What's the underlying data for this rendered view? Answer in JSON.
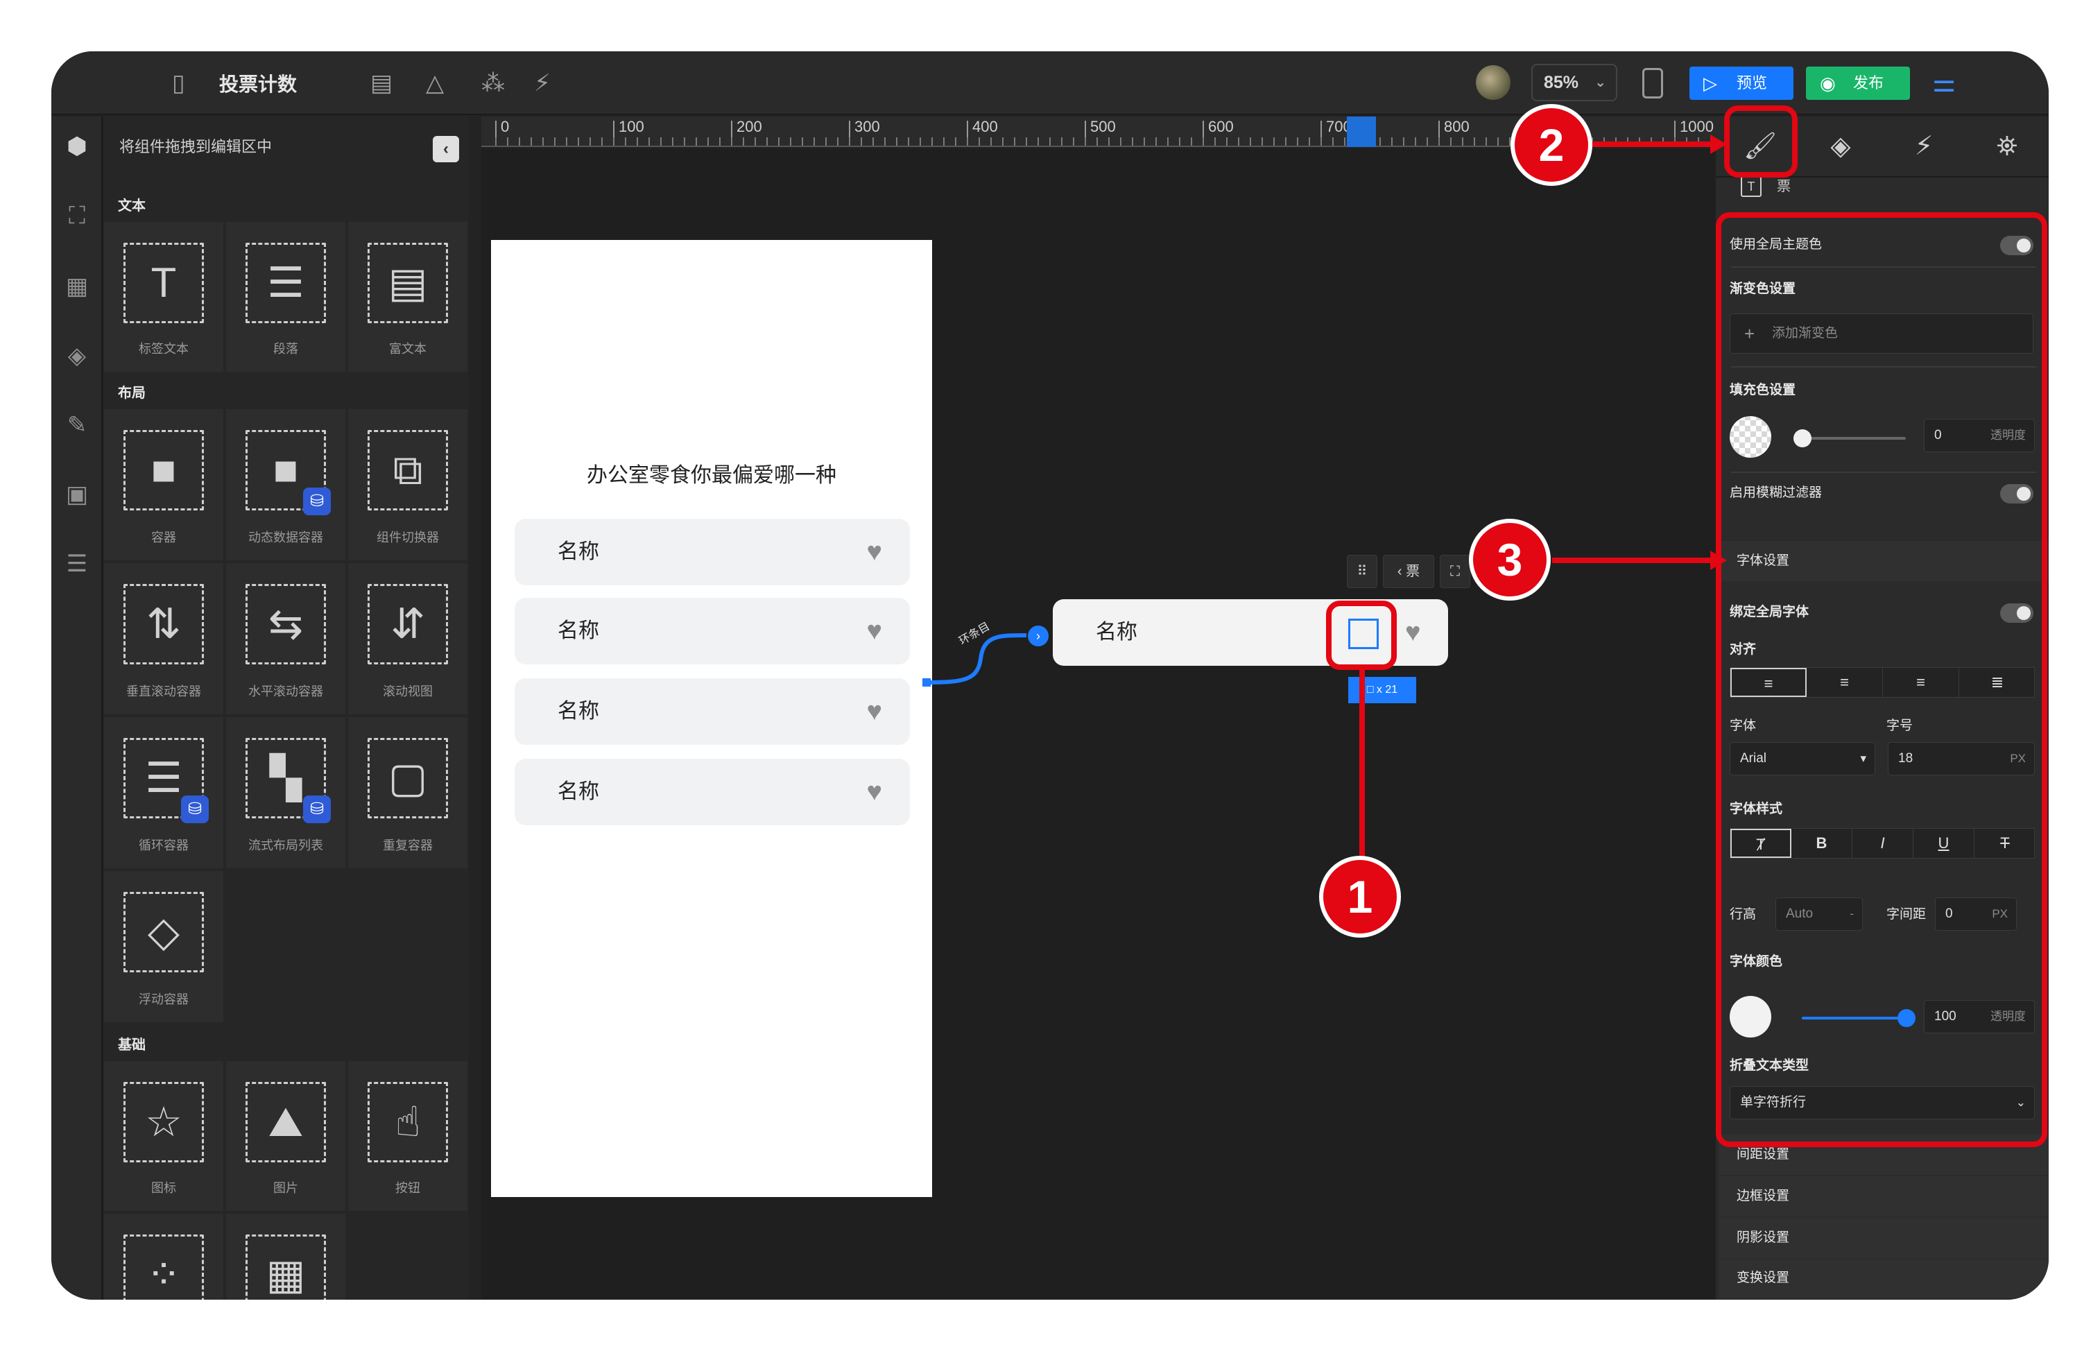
{
  "topbar": {
    "title": "投票计数",
    "zoom": "85%",
    "preview_label": "预览",
    "publish_label": "发布"
  },
  "left_panel": {
    "hint": "将组件拖拽到编辑区中",
    "sections": {
      "text": "文本",
      "layout": "布局",
      "basic": "基础"
    },
    "components": {
      "label_text": "标签文本",
      "paragraph": "段落",
      "rich_text": "富文本",
      "container": "容器",
      "dynamic_container": "动态数据容器",
      "component_switcher": "组件切换器",
      "vertical_scroll": "垂直滚动容器",
      "horizontal_scroll": "水平滚动容器",
      "scroll_view": "滚动视图",
      "loop_container": "循环容器",
      "flow_list": "流式布局列表",
      "repeat_container": "重复容器",
      "floating_container": "浮动容器",
      "icon": "图标",
      "image": "图片",
      "button": "按钮"
    }
  },
  "ruler": {
    "labels": [
      "0",
      "100",
      "200",
      "300",
      "400",
      "500",
      "600",
      "700",
      "800",
      "1000"
    ]
  },
  "canvas": {
    "screen_title": "办公室零食你最偏爱哪一种",
    "options": [
      "名称",
      "名称",
      "名称",
      "名称"
    ],
    "floating_item_name": "名称",
    "flow_label": "环条目",
    "mini_toolbar_tag": "票",
    "size_tag": "□ x 21"
  },
  "right_panel": {
    "element_type_label": "票",
    "use_global_theme": "使用全局主题色",
    "gradient_settings": "渐变色设置",
    "add_gradient": "添加渐变色",
    "fill_settings": "填充色设置",
    "fill_opacity_value": "0",
    "opacity_label": "透明度",
    "blur_filter": "启用模糊过滤器",
    "font_settings": "字体设置",
    "bind_global_font": "绑定全局字体",
    "align_label": "对齐",
    "font_label": "字体",
    "font_size_label": "字号",
    "font_family_value": "Arial",
    "font_size_value": "18",
    "unit_px": "PX",
    "font_style_label": "字体样式",
    "line_height_label": "行高",
    "line_height_value": "Auto",
    "letter_spacing_label": "字间距",
    "letter_spacing_value": "0",
    "font_color_label": "字体颜色",
    "font_color_opacity": "100",
    "fold_text_type_label": "折叠文本类型",
    "fold_text_type_value": "单字符折行",
    "spacing_settings": "间距设置",
    "border_settings": "边框设置",
    "shadow_settings": "阴影设置",
    "transform_settings": "变换设置"
  },
  "annotations": {
    "badge_1": "1",
    "badge_2": "2",
    "badge_3": "3",
    "color": "#e30613"
  },
  "colors": {
    "accent_blue": "#1677ff",
    "publish_green": "#19b66a",
    "background_dark": "#232323"
  }
}
